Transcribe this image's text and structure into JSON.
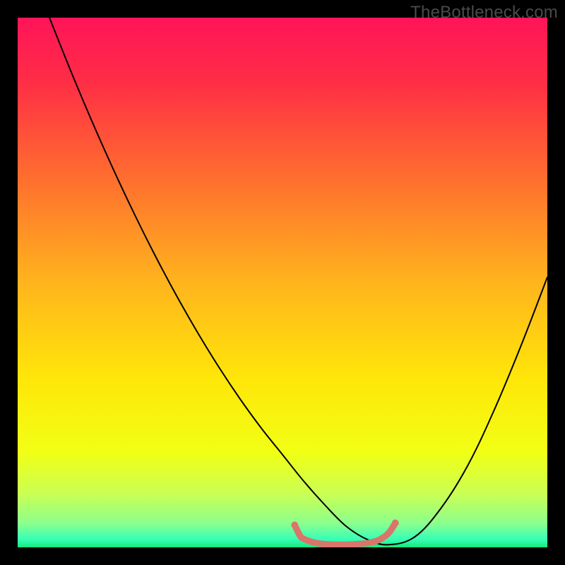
{
  "watermark": "TheBottleneck.com",
  "chart_data": {
    "type": "line",
    "title": "",
    "xlabel": "",
    "ylabel": "",
    "xlim": [
      0,
      100
    ],
    "ylim": [
      0,
      100
    ],
    "gradient_stops": [
      {
        "offset": 0.0,
        "color": "#ff1458"
      },
      {
        "offset": 0.12,
        "color": "#ff2d46"
      },
      {
        "offset": 0.3,
        "color": "#ff6d2f"
      },
      {
        "offset": 0.5,
        "color": "#ffb41d"
      },
      {
        "offset": 0.68,
        "color": "#ffe609"
      },
      {
        "offset": 0.82,
        "color": "#f1ff14"
      },
      {
        "offset": 0.9,
        "color": "#c9ff54"
      },
      {
        "offset": 0.955,
        "color": "#8bff8e"
      },
      {
        "offset": 0.985,
        "color": "#35ffb7"
      },
      {
        "offset": 1.0,
        "color": "#17e77a"
      }
    ],
    "series": [
      {
        "name": "bottleneck-curve",
        "stroke": "#000000",
        "stroke_width": 2,
        "x": [
          6,
          10,
          14,
          18,
          22,
          26,
          30,
          34,
          38,
          42,
          46,
          50,
          54,
          58,
          62,
          66,
          70,
          75,
          80,
          85,
          90,
          95,
          100
        ],
        "y": [
          100,
          90,
          80.5,
          71.5,
          63,
          55,
          47.5,
          40.5,
          34,
          28,
          22.5,
          17.5,
          12.5,
          8,
          4,
          1.5,
          0.5,
          2,
          7.5,
          15.5,
          26,
          38,
          51
        ]
      },
      {
        "name": "optimal-zone-marker",
        "stroke": "#d9756a",
        "stroke_width": 9,
        "x": [
          52.3,
          53.3,
          54,
          56,
          58,
          60,
          62,
          64,
          66,
          68,
          69.5,
          70.3,
          71.3
        ],
        "y": [
          4.2,
          2.2,
          1.6,
          0.9,
          0.6,
          0.5,
          0.5,
          0.6,
          0.8,
          1.3,
          2.2,
          3.0,
          4.6
        ]
      }
    ]
  }
}
